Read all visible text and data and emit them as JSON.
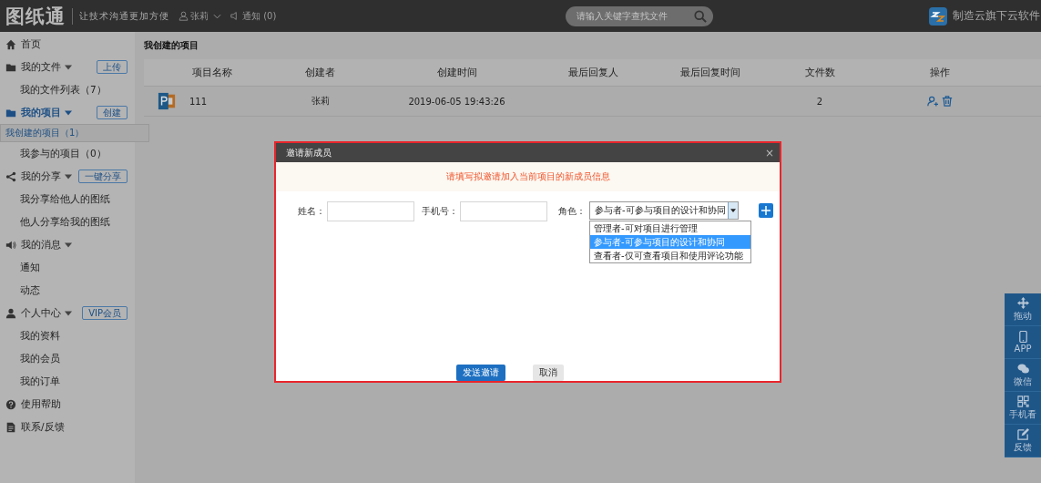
{
  "header": {
    "logo": "图纸通",
    "slogan": "让技术沟通更加方便",
    "user": "张莉",
    "notice": "通知 (0)",
    "search": {
      "placeholder": "请输入关键字查找文件"
    },
    "brand": "制造云旗下云软件"
  },
  "sidebar": [
    {
      "kind": "link",
      "label": "首页"
    },
    {
      "kind": "group",
      "label": "我的文件",
      "expanded": true,
      "action": "上传",
      "children": [
        {
          "label": "我的文件列表（7）",
          "selected": false
        }
      ]
    },
    {
      "kind": "group",
      "label": "我的项目",
      "expanded": true,
      "action": "创建",
      "children": [
        {
          "label": "我创建的项目（1）",
          "selected": true
        },
        {
          "label": "我参与的项目（0）",
          "selected": false
        }
      ]
    },
    {
      "kind": "group",
      "label": "我的分享",
      "expanded": true,
      "action": "一键分享",
      "children": [
        {
          "label": "我分享给他人的图纸",
          "selected": false
        },
        {
          "label": "他人分享给我的图纸",
          "selected": false
        }
      ]
    },
    {
      "kind": "group",
      "label": "我的消息",
      "expanded": true,
      "children": [
        {
          "label": "通知",
          "selected": false
        },
        {
          "label": "动态",
          "selected": false
        }
      ]
    },
    {
      "kind": "group",
      "label": "个人中心",
      "expanded": true,
      "action": "VIP会员",
      "children": [
        {
          "label": "我的资料",
          "selected": false
        },
        {
          "label": "我的会员",
          "selected": false
        },
        {
          "label": "我的订单",
          "selected": false
        }
      ]
    },
    {
      "kind": "link",
      "label": "使用帮助"
    },
    {
      "kind": "link",
      "label": "联系/反馈"
    }
  ],
  "main": {
    "title": "我创建的项目",
    "table": {
      "columns": [
        "项目名称",
        "创建者",
        "创建时间",
        "最后回复人",
        "最后回复时间",
        "文件数",
        "操作"
      ],
      "rows": [
        {
          "name": "111",
          "creator": "张莉",
          "created": "2019-06-05 19:43:26",
          "files": "2"
        }
      ]
    }
  },
  "dialog": {
    "title": "邀请新成员",
    "close": "×",
    "notice": "请填写拟邀请加入当前项目的新成员信息",
    "name_label": "姓名：",
    "phone_label": "手机号：",
    "role_label": "角色：",
    "role_value": "参与者-可参与项目的设计和协同",
    "role_options": [
      {
        "label": "管理者-可对项目进行管理",
        "selected": false
      },
      {
        "label": "参与者-可参与项目的设计和协同",
        "selected": true
      },
      {
        "label": "查看者-仅可查看项目和使用评论功能",
        "selected": false
      }
    ],
    "buttons": [
      {
        "label": "发送邀请",
        "kind": "primary"
      },
      {
        "label": "取消",
        "kind": "secondary"
      }
    ]
  },
  "toolbar": [
    {
      "label": "拖动"
    },
    {
      "label": "APP"
    },
    {
      "label": "微信"
    },
    {
      "label": "手机看"
    },
    {
      "label": "反馈"
    }
  ]
}
